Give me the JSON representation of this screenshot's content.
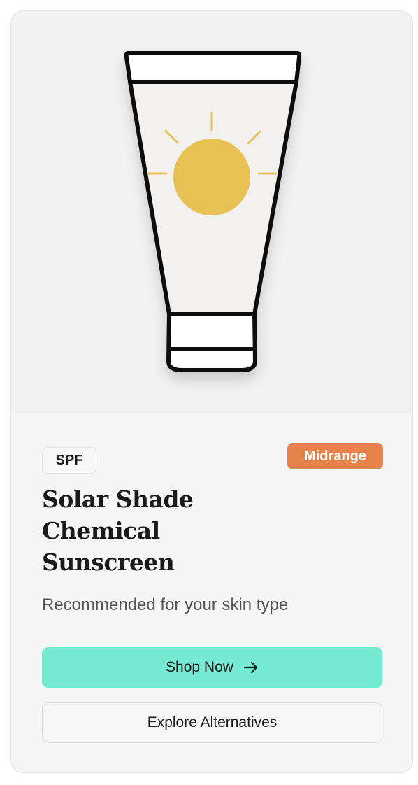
{
  "product": {
    "category": "SPF",
    "price_tier": "Midrange",
    "title_lines": [
      "Solar Shade",
      "Chemical",
      "Sunscreen"
    ],
    "subtitle": "Recommended for your skin type",
    "image_icon": "sunscreen-tube-with-sun-icon"
  },
  "actions": {
    "primary_label": "Shop Now",
    "primary_icon": "arrow-right-icon",
    "secondary_label": "Explore Alternatives"
  },
  "colors": {
    "card_background": "#f5f5f5",
    "price_badge": "#e8824b",
    "primary_button": "#76ead2",
    "sun": "#e8c155",
    "tube_outline": "#111111"
  }
}
